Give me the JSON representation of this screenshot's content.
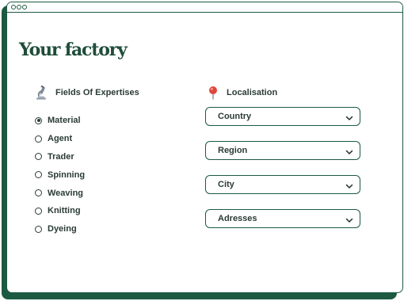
{
  "page": {
    "title": "Your factory"
  },
  "expertise": {
    "heading": "Fields Of Expertises",
    "icon": "microscope-icon",
    "options": [
      {
        "label": "Material",
        "checked": true
      },
      {
        "label": "Agent",
        "checked": false
      },
      {
        "label": "Trader",
        "checked": false
      },
      {
        "label": "Spinning",
        "checked": false
      },
      {
        "label": "Weaving",
        "checked": false
      },
      {
        "label": "Knitting",
        "checked": false
      },
      {
        "label": "Dyeing",
        "checked": false
      }
    ]
  },
  "localisation": {
    "heading": "Localisation",
    "icon": "map-pin-icon",
    "selects": [
      {
        "label": "Country"
      },
      {
        "label": "Region"
      },
      {
        "label": "City"
      },
      {
        "label": "Adresses"
      }
    ]
  },
  "colors": {
    "brand_green": "#1c5a41",
    "text_dark": "#2b3b34",
    "pin_red": "#e0463b"
  }
}
